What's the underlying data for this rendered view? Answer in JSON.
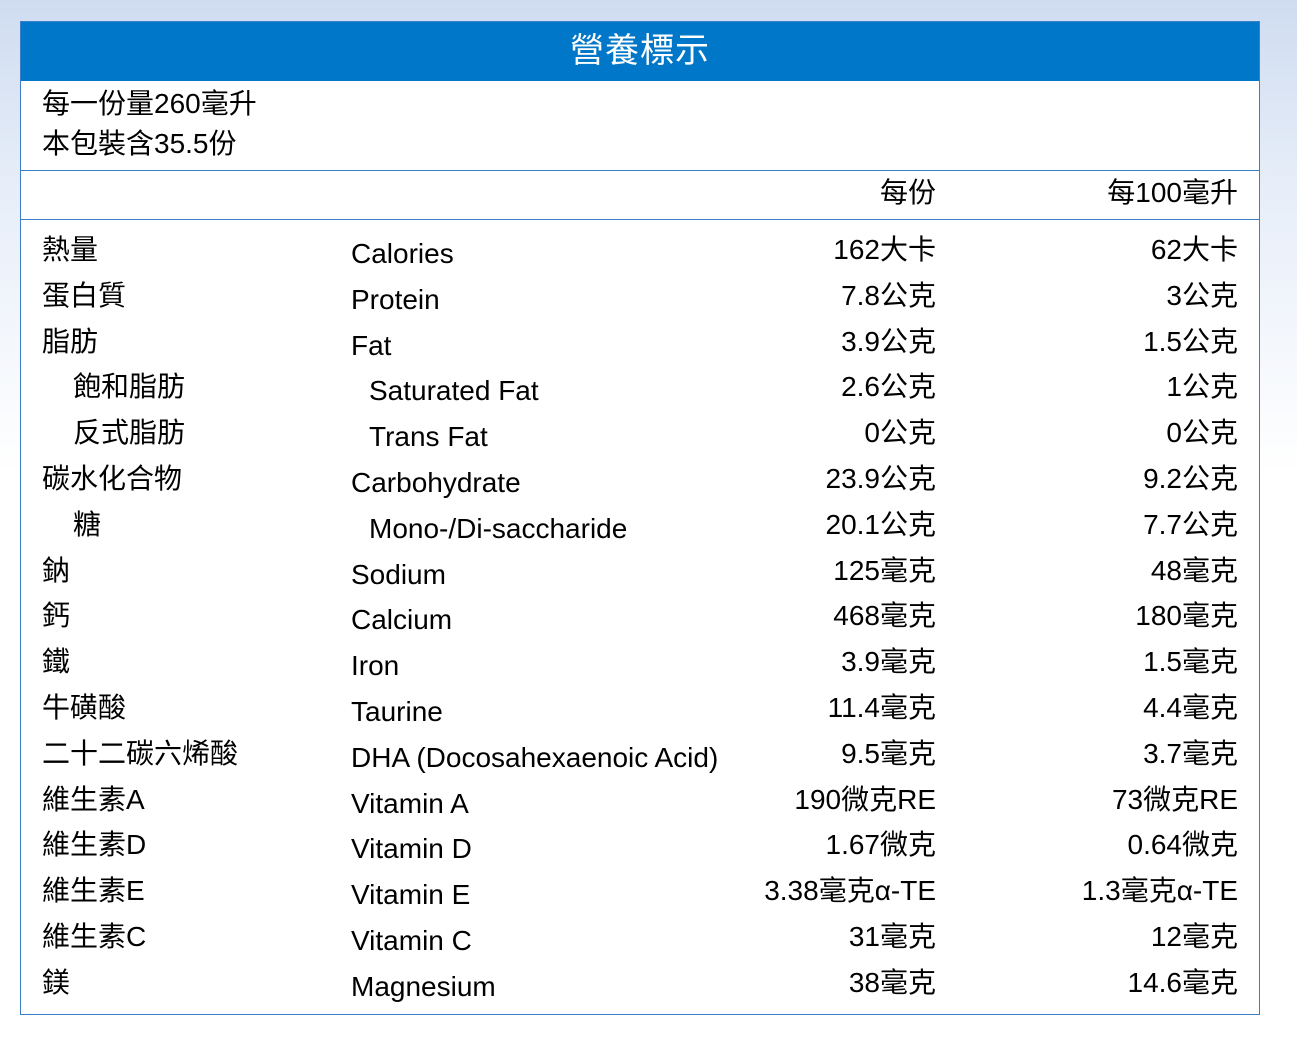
{
  "title": "營養標示",
  "serving": {
    "size": "每一份量260毫升",
    "count": "本包裝含35.5份"
  },
  "columns": {
    "per_serving": "每份",
    "per_100ml": "每100毫升"
  },
  "rows": [
    {
      "cn": "熱量",
      "en": "Calories",
      "per_serving": "162大卡",
      "per_100ml": "62大卡",
      "sub": false
    },
    {
      "cn": "蛋白質",
      "en": "Protein",
      "per_serving": "7.8公克",
      "per_100ml": "3公克",
      "sub": false
    },
    {
      "cn": "脂肪",
      "en": "Fat",
      "per_serving": "3.9公克",
      "per_100ml": "1.5公克",
      "sub": false
    },
    {
      "cn": "飽和脂肪",
      "en": "Saturated Fat",
      "per_serving": "2.6公克",
      "per_100ml": "1公克",
      "sub": true
    },
    {
      "cn": "反式脂肪",
      "en": "Trans Fat",
      "per_serving": "0公克",
      "per_100ml": "0公克",
      "sub": true
    },
    {
      "cn": "碳水化合物",
      "en": "Carbohydrate",
      "per_serving": "23.9公克",
      "per_100ml": "9.2公克",
      "sub": false
    },
    {
      "cn": "糖",
      "en": "Mono-/Di-saccharide",
      "per_serving": "20.1公克",
      "per_100ml": "7.7公克",
      "sub": true
    },
    {
      "cn": "鈉",
      "en": "Sodium",
      "per_serving": "125毫克",
      "per_100ml": "48毫克",
      "sub": false
    },
    {
      "cn": "鈣",
      "en": "Calcium",
      "per_serving": "468毫克",
      "per_100ml": "180毫克",
      "sub": false
    },
    {
      "cn": "鐵",
      "en": "Iron",
      "per_serving": "3.9毫克",
      "per_100ml": "1.5毫克",
      "sub": false
    },
    {
      "cn": "牛磺酸",
      "en": "Taurine",
      "per_serving": "11.4毫克",
      "per_100ml": "4.4毫克",
      "sub": false
    },
    {
      "cn": "二十二碳六烯酸",
      "en": "DHA (Docosahexaenoic Acid)",
      "per_serving": "9.5毫克",
      "per_100ml": "3.7毫克",
      "sub": false
    },
    {
      "cn": "維生素A",
      "en": "Vitamin A",
      "per_serving": "190微克RE",
      "per_100ml": "73微克RE",
      "sub": false
    },
    {
      "cn": "維生素D",
      "en": "Vitamin D",
      "per_serving": "1.67微克",
      "per_100ml": "0.64微克",
      "sub": false
    },
    {
      "cn": "維生素E",
      "en": "Vitamin E",
      "per_serving": "3.38毫克α-TE",
      "per_100ml": "1.3毫克α-TE",
      "sub": false
    },
    {
      "cn": "維生素C",
      "en": "Vitamin C",
      "per_serving": "31毫克",
      "per_100ml": "12毫克",
      "sub": false
    },
    {
      "cn": "鎂",
      "en": "Magnesium",
      "per_serving": "38毫克",
      "per_100ml": "14.6毫克",
      "sub": false
    }
  ],
  "colors": {
    "header_blue": "#0077c8",
    "border_blue": "#3a7fc8"
  }
}
